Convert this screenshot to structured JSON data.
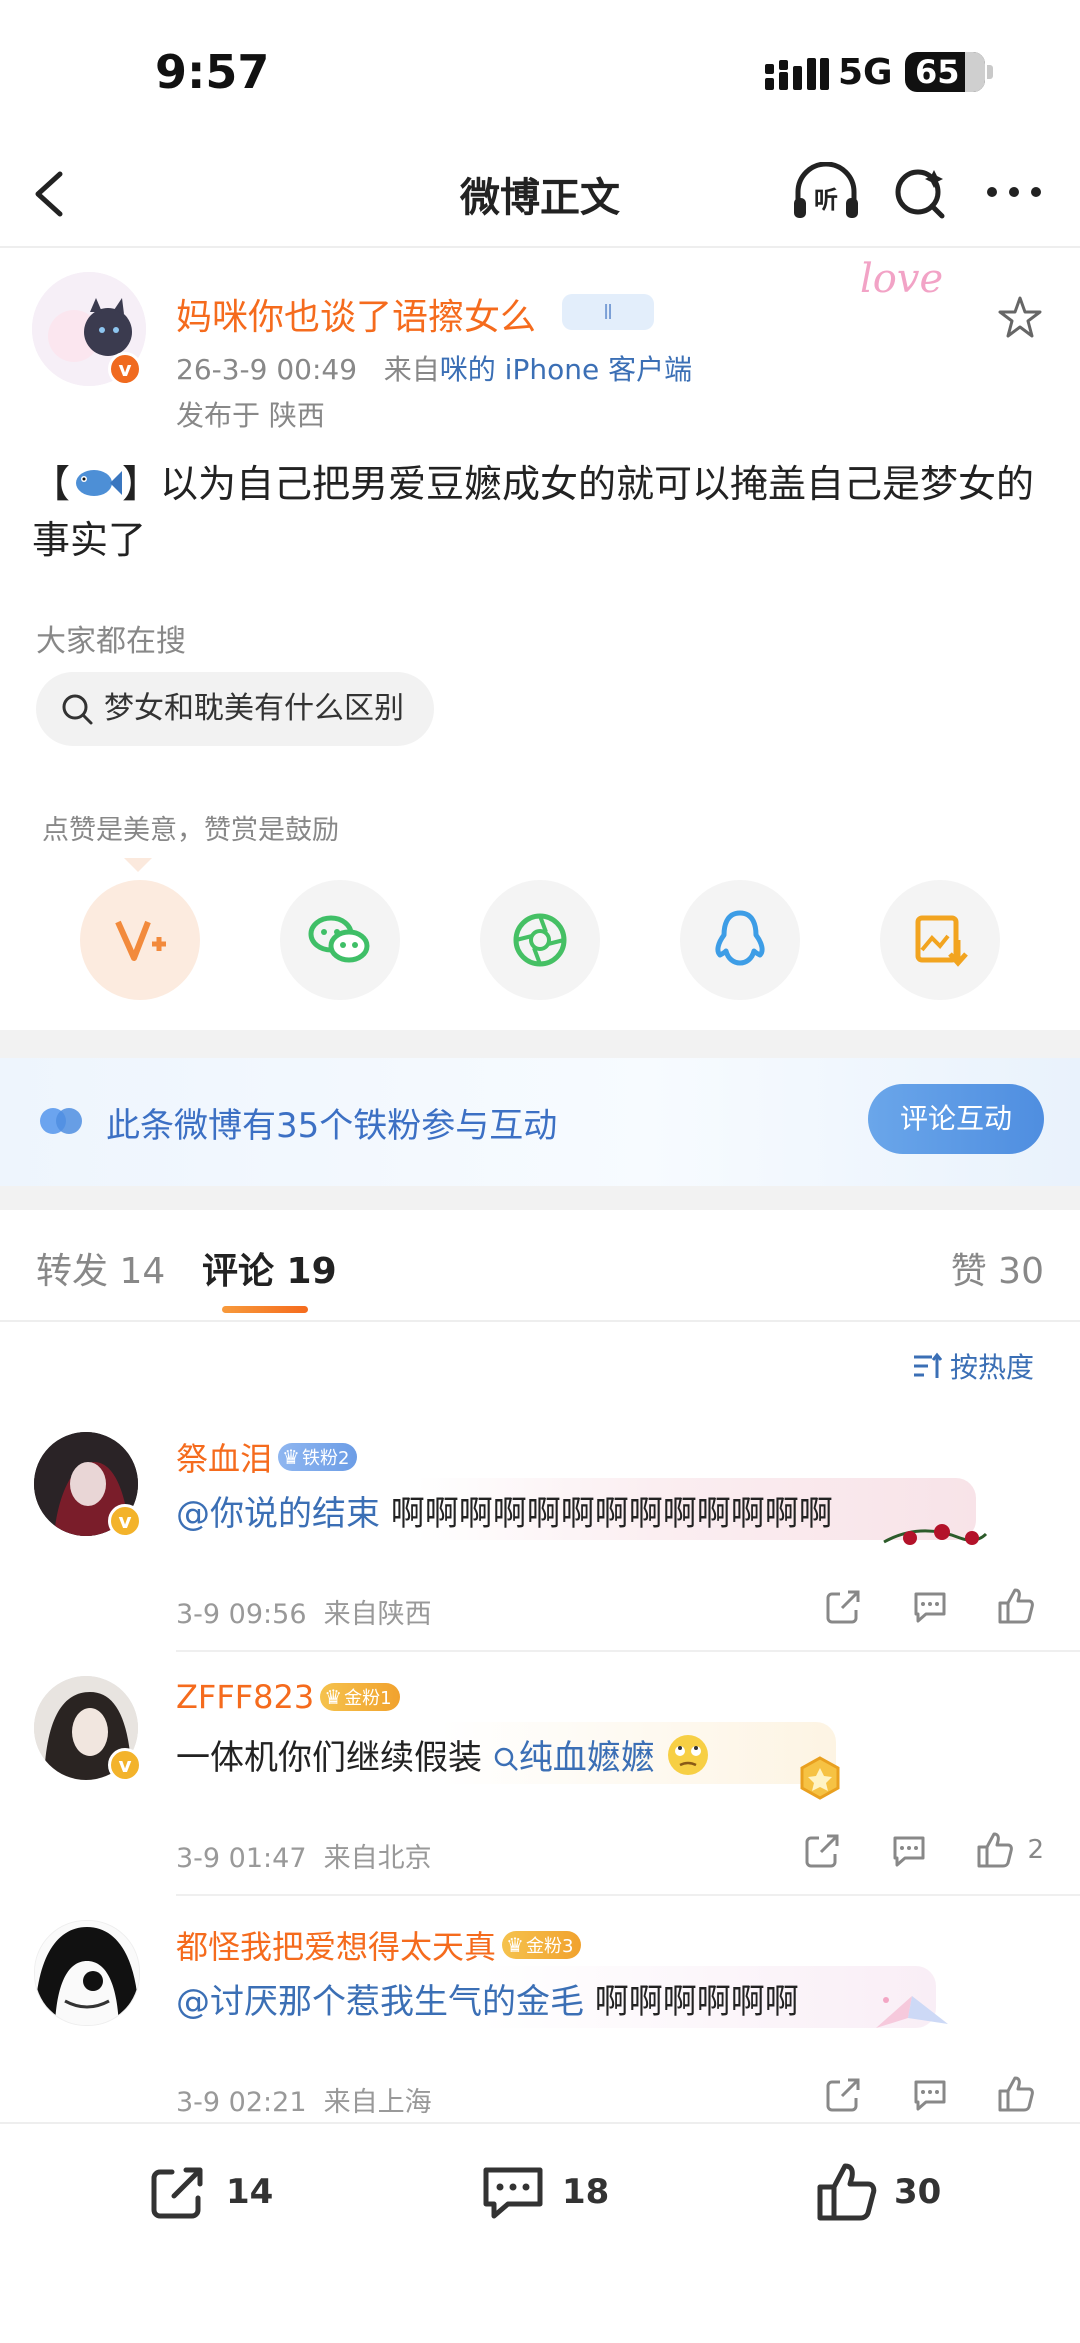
{
  "status_bar": {
    "time": "9:57",
    "network": "5G",
    "battery": "65"
  },
  "nav": {
    "title": "微博正文",
    "listen_label": "听"
  },
  "post": {
    "author": "妈咪你也谈了语擦女么",
    "author_tag": "Ⅱ",
    "timestamp": "26-3-9 00:49",
    "source_prefix": "来自",
    "source": "咪的 iPhone 客户端",
    "location": "发布于 陕西",
    "deco_text": "love",
    "body_open": "【",
    "body_text": "】以为自己把男爱豆嬷成女的就可以掩盖自己是梦女的事实了",
    "searching_label": "大家都在搜",
    "search_query": "梦女和耽美有什么区别"
  },
  "reward": {
    "hint": "点赞是美意，赞赏是鼓励"
  },
  "share_targets": [
    "vip-reward",
    "wechat",
    "moments",
    "qq",
    "save-image"
  ],
  "fan_banner": {
    "text": "此条微博有35个铁粉参与互动",
    "button": "评论互动"
  },
  "tabs": {
    "repost": "转发 14",
    "comments": "评论 19",
    "likes": "赞 30"
  },
  "sort": {
    "label": "按热度"
  },
  "comments": [
    {
      "name": "祭血泪",
      "badge": "铁粉2",
      "mention": "@你说的结束",
      "text": " 啊啊啊啊啊啊啊啊啊啊啊啊啊",
      "time": "3-9 09:56",
      "from": "来自陕西",
      "likes": ""
    },
    {
      "name": "ZFFF823",
      "badge": "金粉1",
      "text": "一体机你们继续假装",
      "link": "纯血嬷嬷",
      "time": "3-9 01:47",
      "from": "来自北京",
      "likes": "2"
    },
    {
      "name": "都怪我把爱想得太天真",
      "badge": "金粉3",
      "mention": "@讨厌那个惹我生气的金毛",
      "text": " 啊啊啊啊啊啊",
      "time": "3-9 02:21",
      "from": "来自上海",
      "likes": ""
    }
  ],
  "bottom_bar": {
    "reposts": "14",
    "comments": "18",
    "likes": "30"
  },
  "colors": {
    "accent_orange": "#f56b1d",
    "link_blue": "#3b6fb5",
    "banner_blue": "#4f8ee0"
  }
}
